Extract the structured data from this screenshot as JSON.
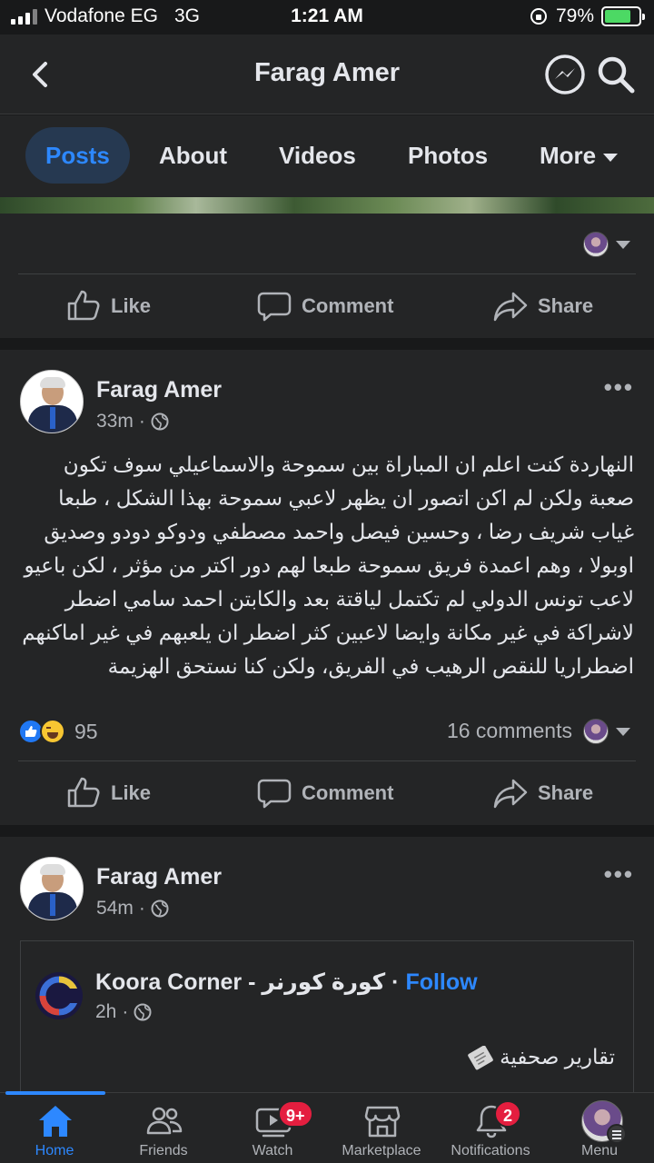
{
  "status_bar": {
    "carrier": "Vodafone EG",
    "network": "3G",
    "time": "1:21 AM",
    "battery": "79%",
    "battery_level": 0.79
  },
  "header": {
    "title": "Farag Amer"
  },
  "tabs": [
    {
      "label": "Posts",
      "active": true
    },
    {
      "label": "About"
    },
    {
      "label": "Videos"
    },
    {
      "label": "Photos"
    },
    {
      "label": "More"
    }
  ],
  "actions": {
    "like": "Like",
    "comment": "Comment",
    "share": "Share"
  },
  "post1": {
    "author": "Farag Amer",
    "time": "33m",
    "text": "النهاردة  كنت اعلم ان المباراة بين سموحة والاسماعيلي سوف تكون صعبة ولكن لم اكن اتصور ان يظهر لاعبي سموحة بهذا الشكل ، طبعا غياب شريف رضا ، وحسين فيصل واحمد مصطفي ودوكو دودو وصديق اوبولا   ،  وهم اعمدة فريق سموحة طبعا لهم دور اكتر من مؤثر ، لكن باعيو لاعب تونس الدولي لم تكتمل لياقتة  بعد والكابتن احمد سامي اضطر لاشراكة في غير مكانة وايضا لاعبين كثر اضطر ان يلعبهم في غير اماكنهم اضطراريا للنقص الرهيب في الفريق، ولكن كنا نستحق الهزيمة",
    "reactions_count": "95",
    "comments": "16 comments"
  },
  "post2": {
    "author": "Farag Amer",
    "time": "54m",
    "shared": {
      "page_name": "Koora Corner - كورة كورنر",
      "follow": "Follow",
      "time": "2h",
      "text": "تقارير صحفية"
    }
  },
  "bottom_nav": [
    {
      "label": "Home",
      "active": true
    },
    {
      "label": "Friends"
    },
    {
      "label": "Watch",
      "badge": "9+"
    },
    {
      "label": "Marketplace"
    },
    {
      "label": "Notifications",
      "badge": "2"
    },
    {
      "label": "Menu"
    }
  ],
  "colors": {
    "background": "#18191a",
    "surface": "#242526",
    "accent": "#2d88ff",
    "badge": "#e41e3f"
  }
}
